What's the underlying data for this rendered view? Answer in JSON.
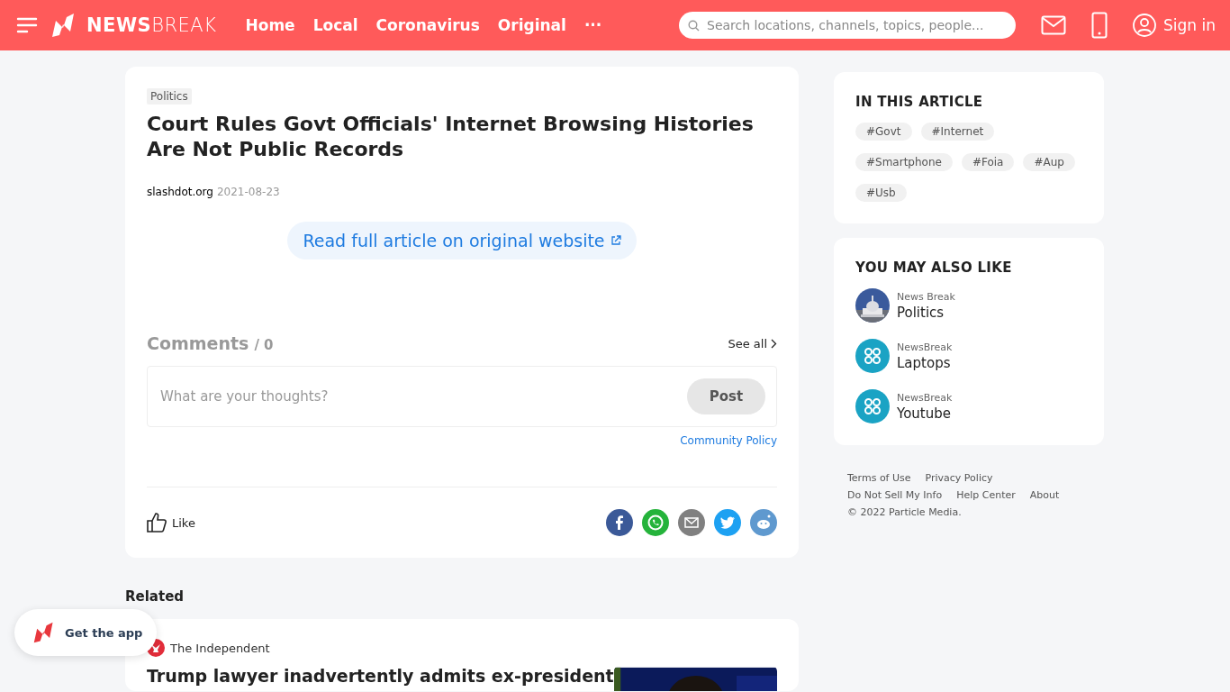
{
  "header": {
    "logo": "**NEWS**BREAK",
    "nav": [
      {
        "label": "Home"
      },
      {
        "label": "Local"
      },
      {
        "label": "Coronavirus"
      },
      {
        "label": "Original"
      }
    ],
    "more": "···",
    "search": {
      "placeholder": "Search locations, channels, topics, people..."
    },
    "sign_in": "Sign in"
  },
  "article": {
    "category": "Politics",
    "title": "Court Rules Govt Officials' Internet Browsing Histories Are Not Public Records",
    "source": "slashdot.org",
    "date": "2021-08-23",
    "read_full": "Read full article on original website"
  },
  "comments": {
    "title": "Comments",
    "count": "/ 0",
    "see_all": "See all",
    "placeholder": "What are your thoughts?",
    "post": "Post",
    "policy": "Community Policy"
  },
  "like": "Like",
  "share": [
    {
      "kind": "facebook",
      "color": "#3b5998"
    },
    {
      "kind": "whatsapp",
      "color": "#25b33b"
    },
    {
      "kind": "email",
      "color": "#808080"
    },
    {
      "kind": "twitter",
      "color": "#1da1f2"
    },
    {
      "kind": "reddit",
      "color": "#5f99cf"
    }
  ],
  "in_this_article": {
    "title": "IN THIS ARTICLE",
    "tags": [
      "#Govt",
      "#Internet",
      "#Smartphone",
      "#Foia",
      "#Aup",
      "#Usb"
    ]
  },
  "also_like": {
    "title": "YOU MAY ALSO LIKE",
    "items": [
      {
        "kind": "picture",
        "source": "News Break",
        "name": "Politics"
      },
      {
        "kind": "icon",
        "source": "NewsBreak",
        "name": "Laptops"
      },
      {
        "kind": "icon",
        "source": "NewsBreak",
        "name": "Youtube"
      }
    ]
  },
  "footer": {
    "links": [
      [
        "Terms of Use",
        "Privacy Policy"
      ],
      [
        "Do Not Sell My Info",
        "Help Center",
        "About"
      ]
    ],
    "copyright": "© 2022 Particle Media."
  },
  "related": {
    "title": "Related",
    "source": "The Independent",
    "headline": "Trump lawyer inadvertently admits ex-president"
  },
  "get_app": "Get the app"
}
